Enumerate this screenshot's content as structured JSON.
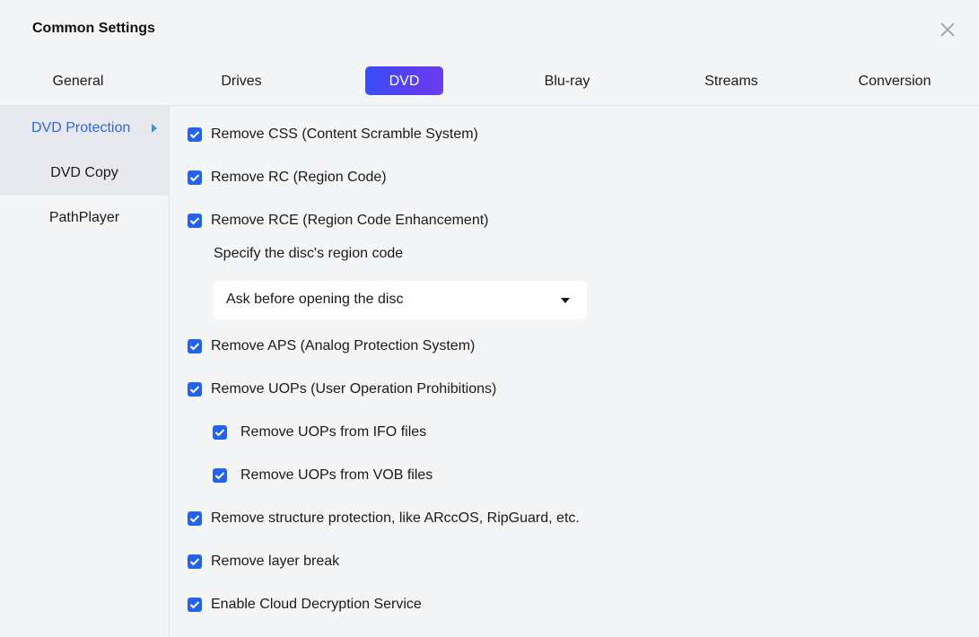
{
  "window": {
    "title": "Common Settings"
  },
  "tabs": [
    {
      "label": "General",
      "active": false
    },
    {
      "label": "Drives",
      "active": false
    },
    {
      "label": "DVD",
      "active": true
    },
    {
      "label": "Blu-ray",
      "active": false
    },
    {
      "label": "Streams",
      "active": false
    },
    {
      "label": "Conversion",
      "active": false
    }
  ],
  "sidebar": {
    "items": [
      {
        "label": "DVD Protection",
        "active": true
      },
      {
        "label": "DVD Copy",
        "active": false
      },
      {
        "label": "PathPlayer",
        "active": false
      }
    ]
  },
  "options": {
    "remove_css": {
      "label": "Remove CSS (Content Scramble System)",
      "checked": true
    },
    "remove_rc": {
      "label": "Remove RC (Region Code)",
      "checked": true
    },
    "remove_rce": {
      "label": "Remove RCE (Region Code Enhancement)",
      "checked": true
    },
    "region_code_label": "Specify the disc's region code",
    "region_code_select": {
      "value": "Ask before opening the disc"
    },
    "remove_aps": {
      "label": "Remove APS (Analog Protection System)",
      "checked": true
    },
    "remove_uops": {
      "label": "Remove UOPs (User Operation Prohibitions)",
      "checked": true
    },
    "remove_uops_ifo": {
      "label": "Remove UOPs from IFO files",
      "checked": true
    },
    "remove_uops_vob": {
      "label": "Remove UOPs from VOB files",
      "checked": true
    },
    "remove_structure": {
      "label": "Remove structure protection, like ARccOS, RipGuard, etc.",
      "checked": true
    },
    "remove_layer_break": {
      "label": "Remove layer break",
      "checked": true
    },
    "cloud_decryption": {
      "label": "Enable Cloud Decryption Service",
      "checked": true
    }
  },
  "colors": {
    "accent": "#2462e8",
    "tab_gradient_start": "#3a4df6",
    "tab_gradient_end": "#6c3cf0",
    "sidebar_active_text": "#2b67e8"
  },
  "icons": {
    "close": "close-icon",
    "checkbox": "checkmark-icon",
    "dropdown": "caret-down-icon",
    "sidebar_arrow": "caret-right-icon"
  }
}
